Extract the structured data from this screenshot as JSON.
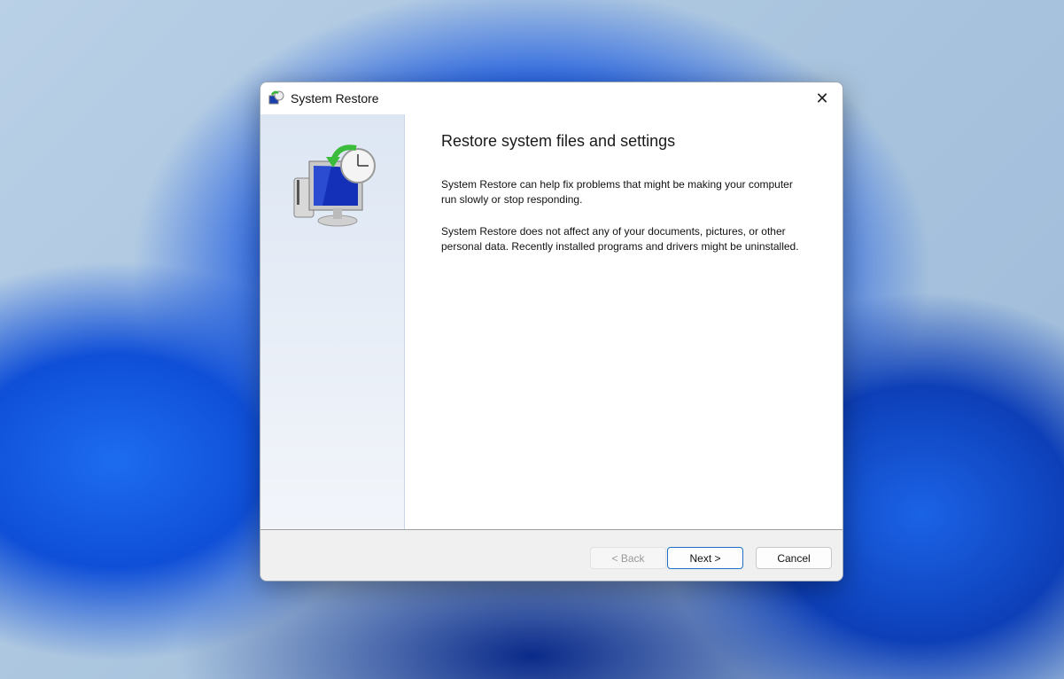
{
  "window": {
    "title": "System Restore",
    "close_icon": "close-icon",
    "app_icon": "system-restore-icon"
  },
  "main": {
    "heading": "Restore system files and settings",
    "paragraphs": [
      "System Restore can help fix problems that might be making your computer run slowly or stop responding.",
      "System Restore does not affect any of your documents, pictures, or other personal data. Recently installed programs and drivers might be uninstalled."
    ]
  },
  "buttons": {
    "back": "< Back",
    "next": "Next >",
    "cancel": "Cancel"
  }
}
